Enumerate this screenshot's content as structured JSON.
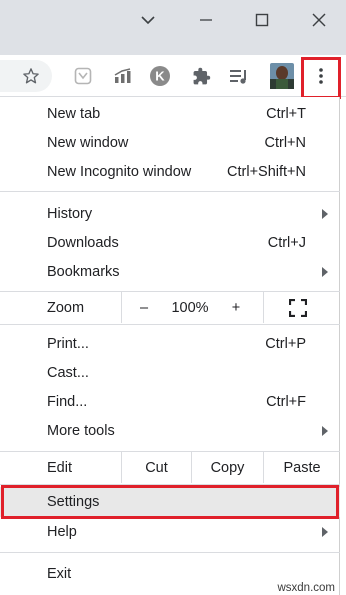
{
  "titlebar": {
    "buttons": [
      {
        "name": "tab-search-icon",
        "icon": "chevron-down"
      },
      {
        "name": "minimize-icon",
        "icon": "minimize"
      },
      {
        "name": "maximize-icon",
        "icon": "maximize"
      },
      {
        "name": "close-icon",
        "icon": "close"
      }
    ]
  },
  "toolbar": {
    "icons": [
      "bookmark-star-icon",
      "extension-grayed-icon",
      "extension-chart-icon",
      "extension-k-icon",
      "extensions-puzzle-icon",
      "media-queue-icon",
      "profile-avatar",
      "more-menu-icon"
    ],
    "k_letter": "K"
  },
  "menu": {
    "new_tab": {
      "label": "New tab",
      "shortcut": "Ctrl+T"
    },
    "new_window": {
      "label": "New window",
      "shortcut": "Ctrl+N"
    },
    "new_incognito": {
      "label": "New Incognito window",
      "shortcut": "Ctrl+Shift+N"
    },
    "history": {
      "label": "History"
    },
    "downloads": {
      "label": "Downloads",
      "shortcut": "Ctrl+J"
    },
    "bookmarks": {
      "label": "Bookmarks"
    },
    "zoom": {
      "label": "Zoom",
      "minus": "–",
      "value": "100%",
      "plus": "+"
    },
    "print": {
      "label": "Print...",
      "shortcut": "Ctrl+P"
    },
    "cast": {
      "label": "Cast..."
    },
    "find": {
      "label": "Find...",
      "shortcut": "Ctrl+F"
    },
    "more_tools": {
      "label": "More tools"
    },
    "edit": {
      "label": "Edit",
      "cut": "Cut",
      "copy": "Copy",
      "paste": "Paste"
    },
    "settings": {
      "label": "Settings"
    },
    "help": {
      "label": "Help"
    },
    "exit": {
      "label": "Exit"
    }
  },
  "watermark": "wsxdn.com",
  "colors": {
    "highlight": "#e0202a",
    "titlebar": "#dee1e6",
    "selected_row": "#e8e8e8"
  }
}
